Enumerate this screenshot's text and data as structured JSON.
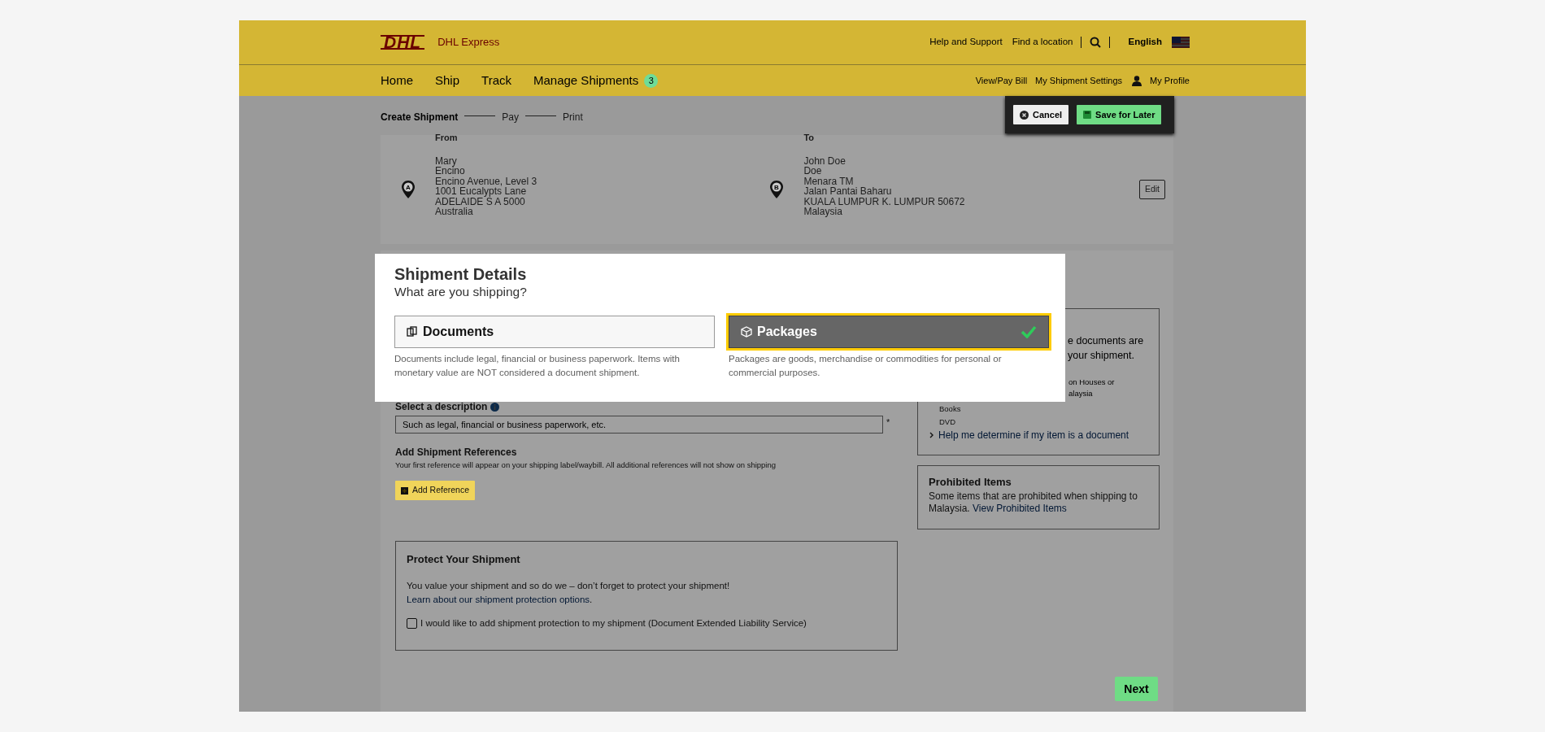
{
  "header": {
    "logo": "DHL",
    "brand": "DHL Express",
    "utility_links": [
      "Help and Support",
      "Find a location"
    ],
    "language": "English"
  },
  "nav": {
    "items": [
      {
        "label": "Home"
      },
      {
        "label": "Ship"
      },
      {
        "label": "Track"
      },
      {
        "label": "Manage Shipments",
        "badge": "3"
      }
    ],
    "account_links": [
      "View/Pay Bill",
      "My Shipment Settings",
      "My Profile"
    ]
  },
  "stepper": [
    {
      "label": "Create Shipment",
      "selected": true
    },
    {
      "label": "Pay",
      "selected": false
    },
    {
      "label": "Print",
      "selected": false
    }
  ],
  "actions": [
    {
      "label": "Cancel",
      "kind": "cancel"
    },
    {
      "label": "Save for Later",
      "kind": "save"
    }
  ],
  "addresses": [
    {
      "heading": "From",
      "marker": "A",
      "lines": [
        "Mary",
        "Encino",
        "Encino Avenue, Level 3",
        "1001 Eucalypts Lane",
        "ADELAIDE S A 5000",
        "Australia"
      ]
    },
    {
      "heading": "To",
      "marker": "B",
      "lines": [
        "John Doe",
        "Doe",
        "Menara TM",
        "Jalan Pantai Baharu",
        "KUALA LUMPUR K. LUMPUR 50672",
        "Malaysia"
      ]
    }
  ],
  "edit_button": "Edit",
  "modal": {
    "title": "Shipment Details",
    "subtitle": "What are you shipping?",
    "options": [
      {
        "label": "Documents",
        "kind": "documents",
        "selected": false,
        "description": "Documents include legal, financial or business paperwork. Items with monetary value are NOT considered a document shipment."
      },
      {
        "label": "Packages",
        "kind": "packages",
        "selected": true,
        "description": "Packages are goods, merchandise or commodities for personal or commercial purposes."
      }
    ]
  },
  "description_field": {
    "label": "Select a description",
    "placeholder": "Such as legal, financial or business paperwork, etc.",
    "required_mark": "*"
  },
  "references": {
    "title": "Add Shipment References",
    "hint": "Your first reference will appear on your shipping label/waybill. All additional references will not show on shipping",
    "button": "Add Reference"
  },
  "protection": {
    "title": "Protect Your Shipment",
    "text": "You value your shipment and so do we – don’t forget to protect your shipment!",
    "link": "Learn about our shipment protection options",
    "text_end": ".",
    "checkbox": {
      "label": "I would like to add shipment protection to my shipment (Document Extended Liability Service)",
      "checked": false
    }
  },
  "document_info": {
    "fragments": [
      "e documents are",
      "your shipment."
    ],
    "small_fragments": [
      "on Houses or",
      "alaysia"
    ],
    "examples": [
      "Books",
      "DVD"
    ],
    "help_link": "Help me determine if my item is a document"
  },
  "prohibited": {
    "title": "Prohibited Items",
    "text": "Some items that are prohibited when shipping to Malaysia.",
    "link": "View Prohibited Items"
  },
  "next_button": "Next"
}
